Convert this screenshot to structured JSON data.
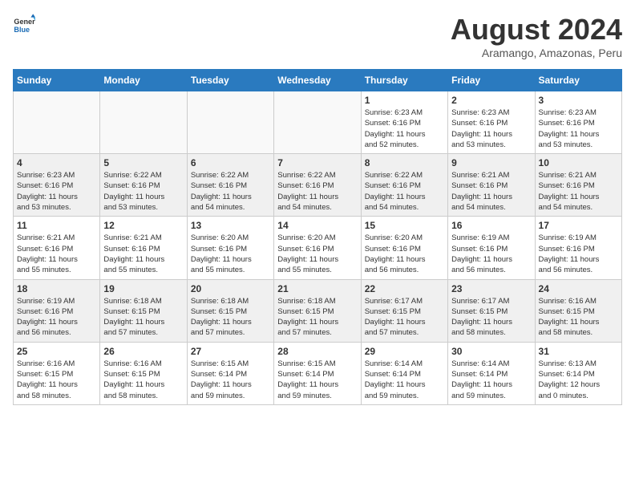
{
  "header": {
    "logo_line1": "General",
    "logo_line2": "Blue",
    "month_title": "August 2024",
    "location": "Aramango, Amazonas, Peru"
  },
  "days_of_week": [
    "Sunday",
    "Monday",
    "Tuesday",
    "Wednesday",
    "Thursday",
    "Friday",
    "Saturday"
  ],
  "weeks": [
    [
      {
        "day": "",
        "info": ""
      },
      {
        "day": "",
        "info": ""
      },
      {
        "day": "",
        "info": ""
      },
      {
        "day": "",
        "info": ""
      },
      {
        "day": "1",
        "info": "Sunrise: 6:23 AM\nSunset: 6:16 PM\nDaylight: 11 hours\nand 52 minutes."
      },
      {
        "day": "2",
        "info": "Sunrise: 6:23 AM\nSunset: 6:16 PM\nDaylight: 11 hours\nand 53 minutes."
      },
      {
        "day": "3",
        "info": "Sunrise: 6:23 AM\nSunset: 6:16 PM\nDaylight: 11 hours\nand 53 minutes."
      }
    ],
    [
      {
        "day": "4",
        "info": "Sunrise: 6:23 AM\nSunset: 6:16 PM\nDaylight: 11 hours\nand 53 minutes."
      },
      {
        "day": "5",
        "info": "Sunrise: 6:22 AM\nSunset: 6:16 PM\nDaylight: 11 hours\nand 53 minutes."
      },
      {
        "day": "6",
        "info": "Sunrise: 6:22 AM\nSunset: 6:16 PM\nDaylight: 11 hours\nand 54 minutes."
      },
      {
        "day": "7",
        "info": "Sunrise: 6:22 AM\nSunset: 6:16 PM\nDaylight: 11 hours\nand 54 minutes."
      },
      {
        "day": "8",
        "info": "Sunrise: 6:22 AM\nSunset: 6:16 PM\nDaylight: 11 hours\nand 54 minutes."
      },
      {
        "day": "9",
        "info": "Sunrise: 6:21 AM\nSunset: 6:16 PM\nDaylight: 11 hours\nand 54 minutes."
      },
      {
        "day": "10",
        "info": "Sunrise: 6:21 AM\nSunset: 6:16 PM\nDaylight: 11 hours\nand 54 minutes."
      }
    ],
    [
      {
        "day": "11",
        "info": "Sunrise: 6:21 AM\nSunset: 6:16 PM\nDaylight: 11 hours\nand 55 minutes."
      },
      {
        "day": "12",
        "info": "Sunrise: 6:21 AM\nSunset: 6:16 PM\nDaylight: 11 hours\nand 55 minutes."
      },
      {
        "day": "13",
        "info": "Sunrise: 6:20 AM\nSunset: 6:16 PM\nDaylight: 11 hours\nand 55 minutes."
      },
      {
        "day": "14",
        "info": "Sunrise: 6:20 AM\nSunset: 6:16 PM\nDaylight: 11 hours\nand 55 minutes."
      },
      {
        "day": "15",
        "info": "Sunrise: 6:20 AM\nSunset: 6:16 PM\nDaylight: 11 hours\nand 56 minutes."
      },
      {
        "day": "16",
        "info": "Sunrise: 6:19 AM\nSunset: 6:16 PM\nDaylight: 11 hours\nand 56 minutes."
      },
      {
        "day": "17",
        "info": "Sunrise: 6:19 AM\nSunset: 6:16 PM\nDaylight: 11 hours\nand 56 minutes."
      }
    ],
    [
      {
        "day": "18",
        "info": "Sunrise: 6:19 AM\nSunset: 6:16 PM\nDaylight: 11 hours\nand 56 minutes."
      },
      {
        "day": "19",
        "info": "Sunrise: 6:18 AM\nSunset: 6:15 PM\nDaylight: 11 hours\nand 57 minutes."
      },
      {
        "day": "20",
        "info": "Sunrise: 6:18 AM\nSunset: 6:15 PM\nDaylight: 11 hours\nand 57 minutes."
      },
      {
        "day": "21",
        "info": "Sunrise: 6:18 AM\nSunset: 6:15 PM\nDaylight: 11 hours\nand 57 minutes."
      },
      {
        "day": "22",
        "info": "Sunrise: 6:17 AM\nSunset: 6:15 PM\nDaylight: 11 hours\nand 57 minutes."
      },
      {
        "day": "23",
        "info": "Sunrise: 6:17 AM\nSunset: 6:15 PM\nDaylight: 11 hours\nand 58 minutes."
      },
      {
        "day": "24",
        "info": "Sunrise: 6:16 AM\nSunset: 6:15 PM\nDaylight: 11 hours\nand 58 minutes."
      }
    ],
    [
      {
        "day": "25",
        "info": "Sunrise: 6:16 AM\nSunset: 6:15 PM\nDaylight: 11 hours\nand 58 minutes."
      },
      {
        "day": "26",
        "info": "Sunrise: 6:16 AM\nSunset: 6:15 PM\nDaylight: 11 hours\nand 58 minutes."
      },
      {
        "day": "27",
        "info": "Sunrise: 6:15 AM\nSunset: 6:14 PM\nDaylight: 11 hours\nand 59 minutes."
      },
      {
        "day": "28",
        "info": "Sunrise: 6:15 AM\nSunset: 6:14 PM\nDaylight: 11 hours\nand 59 minutes."
      },
      {
        "day": "29",
        "info": "Sunrise: 6:14 AM\nSunset: 6:14 PM\nDaylight: 11 hours\nand 59 minutes."
      },
      {
        "day": "30",
        "info": "Sunrise: 6:14 AM\nSunset: 6:14 PM\nDaylight: 11 hours\nand 59 minutes."
      },
      {
        "day": "31",
        "info": "Sunrise: 6:13 AM\nSunset: 6:14 PM\nDaylight: 12 hours\nand 0 minutes."
      }
    ]
  ]
}
